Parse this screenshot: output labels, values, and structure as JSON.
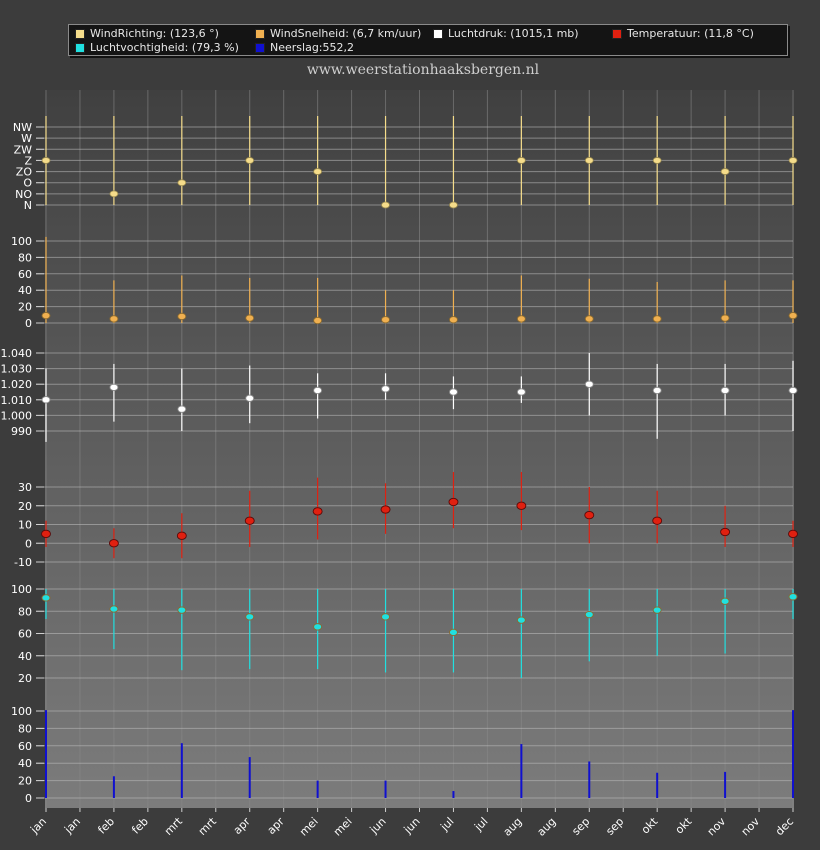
{
  "site_title": "www.weerstationhaaksbergen.nl",
  "legend": [
    {
      "label": "WindRichting: (123,6 °)",
      "color": "#f5dc8a"
    },
    {
      "label": "WindSnelheid: (6,7 km/uur)",
      "color": "#f0b050"
    },
    {
      "label": "Luchtdruk: (1015,1 mb)",
      "color": "#ffffff"
    },
    {
      "label": "Temperatuur: (11,8 °C)",
      "color": "#e02010"
    },
    {
      "label": "Luchtvochtigheid: (79,3 %)",
      "color": "#20e0e0"
    },
    {
      "label": "Neerslag:552,2",
      "color": "#1010d0"
    }
  ],
  "chart_data": {
    "type": "scatter",
    "x_tick_labels": [
      "jan",
      "jan",
      "feb",
      "feb",
      "mrt",
      "mrt",
      "apr",
      "apr",
      "mei",
      "mei",
      "jun",
      "jun",
      "jul",
      "jul",
      "aug",
      "aug",
      "sep",
      "sep",
      "okt",
      "okt",
      "nov",
      "nov",
      "dec"
    ],
    "x": [
      "jan",
      "feb",
      "mrt",
      "apr",
      "mei",
      "jun",
      "jul",
      "aug",
      "sep",
      "okt",
      "nov",
      "dec"
    ],
    "panels": [
      {
        "name": "WindRichting",
        "y_tick_labels": [
          "N",
          "NO",
          "O",
          "ZO",
          "Z",
          "ZW",
          "W",
          "NW"
        ],
        "color": "#f5dc8a",
        "values": [
          "Z",
          "NO",
          "O",
          "Z",
          "ZO",
          "N",
          "N",
          "Z",
          "Z",
          "Z",
          "ZO",
          "Z"
        ]
      },
      {
        "name": "WindSnelheid",
        "ylim": [
          0,
          110
        ],
        "y_tick_labels": [
          "0",
          "20",
          "40",
          "60",
          "80",
          "100"
        ],
        "color": "#f0b050",
        "values": [
          9,
          5,
          8,
          6,
          3,
          4,
          4,
          5,
          5,
          5,
          6,
          9
        ],
        "max": [
          105,
          52,
          58,
          55,
          55,
          40,
          40,
          58,
          54,
          50,
          52,
          52
        ]
      },
      {
        "name": "Luchtdruk",
        "ylim": [
          980,
          1045
        ],
        "y_tick_labels": [
          "990",
          "1.000",
          "1.010",
          "1.020",
          "1.030",
          "1.040"
        ],
        "color": "#ffffff",
        "values": [
          1010,
          1018,
          1004,
          1011,
          1016,
          1017,
          1015,
          1015,
          1020,
          1016,
          1016,
          1016
        ],
        "min": [
          983,
          996,
          990,
          995,
          998,
          1010,
          1004,
          1008,
          1000,
          985,
          1000,
          990
        ],
        "max": [
          1030,
          1033,
          1030,
          1032,
          1027,
          1027,
          1025,
          1025,
          1040,
          1033,
          1033,
          1035
        ]
      },
      {
        "name": "Temperatuur",
        "ylim": [
          -13,
          40
        ],
        "y_tick_labels": [
          "-10",
          "0",
          "10",
          "20",
          "30"
        ],
        "color": "#e02010",
        "values": [
          5,
          0,
          4,
          12,
          17,
          18,
          22,
          20,
          15,
          12,
          6,
          5
        ],
        "min": [
          -2,
          -8,
          -8,
          -2,
          2,
          5,
          8,
          7,
          0,
          0,
          -2,
          -2
        ],
        "max": [
          12,
          8,
          16,
          28,
          35,
          32,
          38,
          38,
          30,
          28,
          20,
          12
        ]
      },
      {
        "name": "Luchtvochtigheid",
        "ylim": [
          13,
          100
        ],
        "y_tick_labels": [
          "20",
          "40",
          "60",
          "80",
          "100"
        ],
        "color": "#20e0e0",
        "values": [
          92,
          82,
          81,
          75,
          66,
          75,
          61,
          72,
          77,
          81,
          89,
          93
        ],
        "min": [
          73,
          46,
          27,
          28,
          28,
          25,
          25,
          20,
          35,
          40,
          42,
          73
        ],
        "max": [
          100,
          100,
          100,
          100,
          100,
          100,
          100,
          100,
          100,
          100,
          100,
          100
        ]
      },
      {
        "name": "Neerslag",
        "ylim": [
          0,
          110
        ],
        "y_tick_labels": [
          "0",
          "20",
          "40",
          "60",
          "80",
          "100"
        ],
        "color": "#1010d0",
        "values": [
          101,
          25,
          63,
          47,
          20,
          20,
          8,
          62,
          42,
          29,
          30,
          101
        ]
      }
    ]
  }
}
